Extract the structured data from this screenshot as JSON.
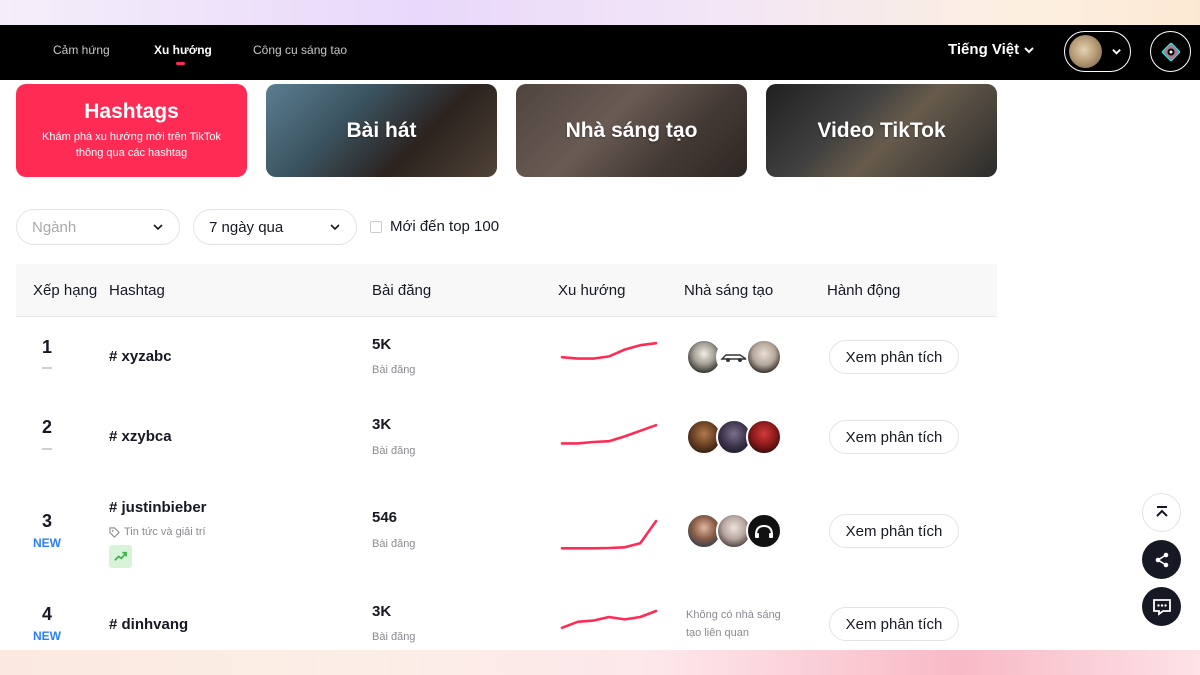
{
  "nav": {
    "items": [
      "Cảm hứng",
      "Xu hướng",
      "Công cụ sáng tạo"
    ],
    "language": "Tiếng Việt"
  },
  "cards": {
    "hashtag_title": "Hashtags",
    "hashtag_sub": "Khám phá xu hướng mới trên TikTok thông qua các hashtag",
    "song_title": "Bài hát",
    "creator_title": "Nhà sáng tạo",
    "video_title": "Video TikTok"
  },
  "filters": {
    "industry_placeholder": "Ngành",
    "period": "7 ngày qua",
    "new_top_label": "Mới đến top 100"
  },
  "table": {
    "headers": [
      "Xếp hạng",
      "Hashtag",
      "Bài đăng",
      "Xu hướng",
      "Nhà sáng tạo",
      "Hành động"
    ],
    "posts_label": "Bài đăng",
    "action_label": "Xem phân tích",
    "new_label": "NEW",
    "no_creator_label": "Không có nhà sáng tạo liên quan",
    "rows": [
      {
        "rank": "1",
        "hashtag": "# xyzabc",
        "posts": "5K",
        "trend": [
          0.35,
          0.3,
          0.3,
          0.38,
          0.62,
          0.78,
          0.85
        ]
      },
      {
        "rank": "2",
        "hashtag": "# xzybca",
        "posts": "3K",
        "trend": [
          0.2,
          0.2,
          0.25,
          0.28,
          0.45,
          0.65,
          0.85
        ]
      },
      {
        "rank": "3",
        "hashtag": "# justinbieber",
        "industry": "Tin tức và giải trí",
        "posts": "546",
        "trend": [
          0.05,
          0.05,
          0.05,
          0.06,
          0.08,
          0.2,
          0.85
        ]
      },
      {
        "rank": "4",
        "hashtag": "# dinhvang",
        "posts": "3K",
        "trend": [
          0.05,
          0.3,
          0.35,
          0.5,
          0.4,
          0.5,
          0.75
        ]
      }
    ]
  },
  "colors": {
    "accent": "#fe2c55",
    "new_badge": "#2a7fff",
    "trend_line": "#fe2c55"
  },
  "icons": [
    "chevron-down-icon",
    "tag-icon",
    "trending-up-icon",
    "back-to-top-icon",
    "share-icon",
    "chat-icon"
  ]
}
